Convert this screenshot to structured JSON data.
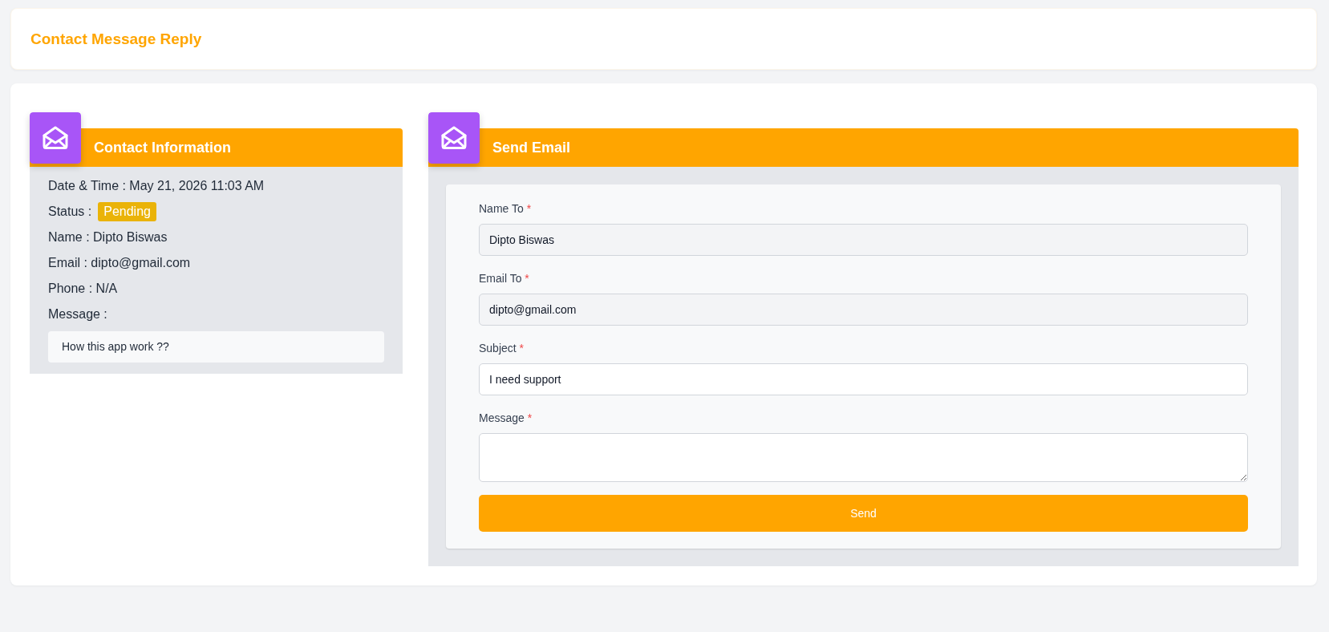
{
  "page": {
    "title": "Contact Message Reply"
  },
  "contact_panel": {
    "title": "Contact Information",
    "rows": [
      {
        "kind": "text",
        "label": "Date & Time :",
        "value": "May 21, 2026 11:03 AM"
      },
      {
        "kind": "badge",
        "label": "Status :",
        "value": "Pending"
      },
      {
        "kind": "text",
        "label": "Name :",
        "value": "Dipto Biswas"
      },
      {
        "kind": "text",
        "label": "Email :",
        "value": "dipto@gmail.com"
      },
      {
        "kind": "text",
        "label": "Phone :",
        "value": "N/A"
      },
      {
        "kind": "message",
        "label": "Message :",
        "value": "How this app work ??"
      }
    ]
  },
  "email_panel": {
    "title": "Send Email",
    "fields": [
      {
        "kind": "input",
        "label": "Name To",
        "required_mark": "*",
        "value": "Dipto Biswas",
        "readonly": true
      },
      {
        "kind": "input",
        "label": "Email To",
        "required_mark": "*",
        "value": "dipto@gmail.com",
        "readonly": true
      },
      {
        "kind": "input",
        "label": "Subject",
        "required_mark": "*",
        "value": "I need support",
        "readonly": false
      },
      {
        "kind": "textarea",
        "label": "Message",
        "required_mark": "*",
        "readonly": false
      }
    ],
    "button": "Send"
  }
}
